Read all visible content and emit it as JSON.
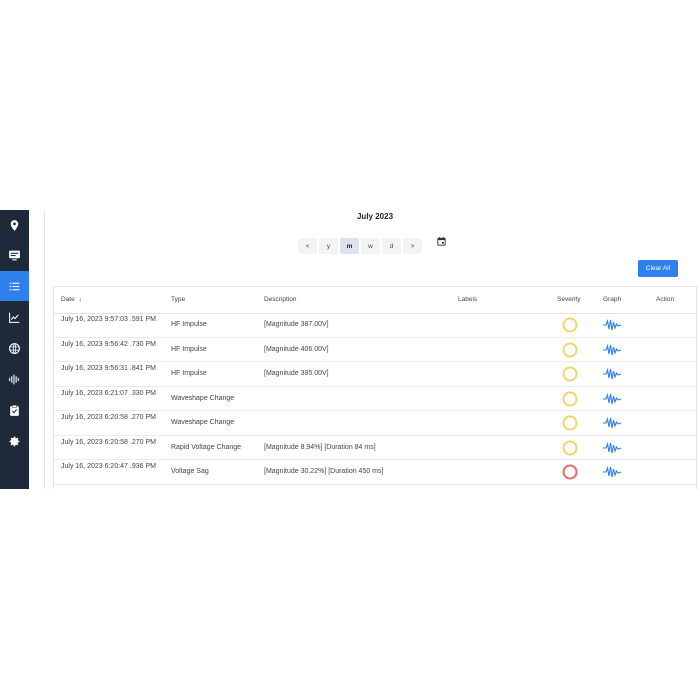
{
  "sidebar": {
    "items": [
      {
        "icon": "location-pin-icon",
        "active": false
      },
      {
        "icon": "monitor-icon",
        "active": false
      },
      {
        "icon": "list-icon",
        "active": true
      },
      {
        "icon": "line-chart-icon",
        "active": false
      },
      {
        "icon": "globe-icon",
        "active": false
      },
      {
        "icon": "waveform-icon",
        "active": false
      },
      {
        "icon": "clipboard-check-icon",
        "active": false
      },
      {
        "icon": "gear-icon",
        "active": false
      }
    ],
    "background": "#1e2a3a",
    "accent": "#2f80ed"
  },
  "calendar": {
    "title": "July 2023",
    "prev_label": "<",
    "next_label": ">",
    "periods": [
      "y",
      "m",
      "w",
      "d"
    ],
    "active_period": "m",
    "calendar_icon": "calendar-icon"
  },
  "toolbar": {
    "clear_all_label": "Clear All"
  },
  "table": {
    "columns": {
      "date": "Date",
      "type": "Type",
      "description": "Description",
      "labels": "Labels",
      "severity": "Severity",
      "graph": "Graph",
      "action": "Action"
    },
    "sort_indicator": "↓",
    "rows": [
      {
        "date": "July 16, 2023 9:57:03 .591 PM",
        "type": "HF Impulse",
        "description": "[Magnitude 387.00V]",
        "labels": "",
        "severity": "warning"
      },
      {
        "date": "July 16, 2023 9:56:42 .730 PM",
        "type": "HF Impulse",
        "description": "[Magnitude 406.00V]",
        "labels": "",
        "severity": "warning"
      },
      {
        "date": "July 16, 2023 9:56:31 .841 PM",
        "type": "HF Impulse",
        "description": "[Magnitude 385.00V]",
        "labels": "",
        "severity": "warning"
      },
      {
        "date": "July 16, 2023 6:21:07 .330 PM",
        "type": "Waveshape Change",
        "description": "",
        "labels": "",
        "severity": "warning"
      },
      {
        "date": "July 16, 2023 6:20:58 .270 PM",
        "type": "Waveshape Change",
        "description": "",
        "labels": "",
        "severity": "warning"
      },
      {
        "date": "July 16, 2023 6:20:58 .270 PM",
        "type": "Rapid Voltage Change",
        "description": "[Magnitude 8.94%] [Duration 84 ms]",
        "labels": "",
        "severity": "warning"
      },
      {
        "date": "July 16, 2023 6:20:47 .936 PM",
        "type": "Voltage Sag",
        "description": "[Magnitude 30.22%] [Duration 450 ms]",
        "labels": "",
        "severity": "critical"
      }
    ]
  },
  "colors": {
    "severity_warning": "#f5d36b",
    "severity_critical": "#e86a6a",
    "graph_icon": "#2f80ed"
  }
}
